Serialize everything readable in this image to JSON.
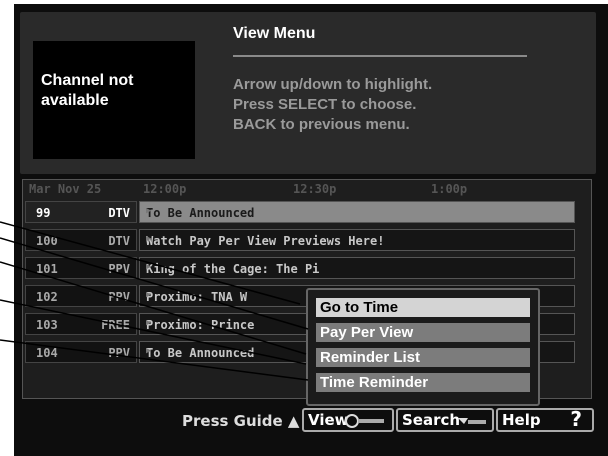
{
  "info_panel": {
    "preview_text_line1": "Channel not",
    "preview_text_line2": "available",
    "menu_title": "View Menu",
    "instructions": [
      "Arrow up/down to highlight.",
      "Press SELECT to choose.",
      "BACK to previous menu."
    ]
  },
  "guide": {
    "date": "Mar Nov 25",
    "times": [
      "12:00p",
      "12:30p",
      "1:00p"
    ],
    "rows": [
      {
        "number": "99",
        "network": "DTV",
        "program": "To Be Announced"
      },
      {
        "number": "100",
        "network": "DTV",
        "program": "Watch Pay Per View Previews Here!"
      },
      {
        "number": "101",
        "network": "PPV",
        "program": "King of the Cage: The Pi"
      },
      {
        "number": "102",
        "network": "PPV",
        "program": "Proximo: TNA W"
      },
      {
        "number": "103",
        "network": "FREE",
        "program": "Proximo: Prince"
      },
      {
        "number": "104",
        "network": "PPV",
        "program": "To Be Announced"
      }
    ]
  },
  "popup_menu": {
    "items": [
      "Go to Time",
      "Pay Per View",
      "Reminder List",
      "Time Reminder"
    ]
  },
  "bottom_bar": {
    "press_guide": "Press Guide",
    "view_label": "View",
    "search_label": "Search",
    "help_label": "Help",
    "help_symbol": "?"
  }
}
